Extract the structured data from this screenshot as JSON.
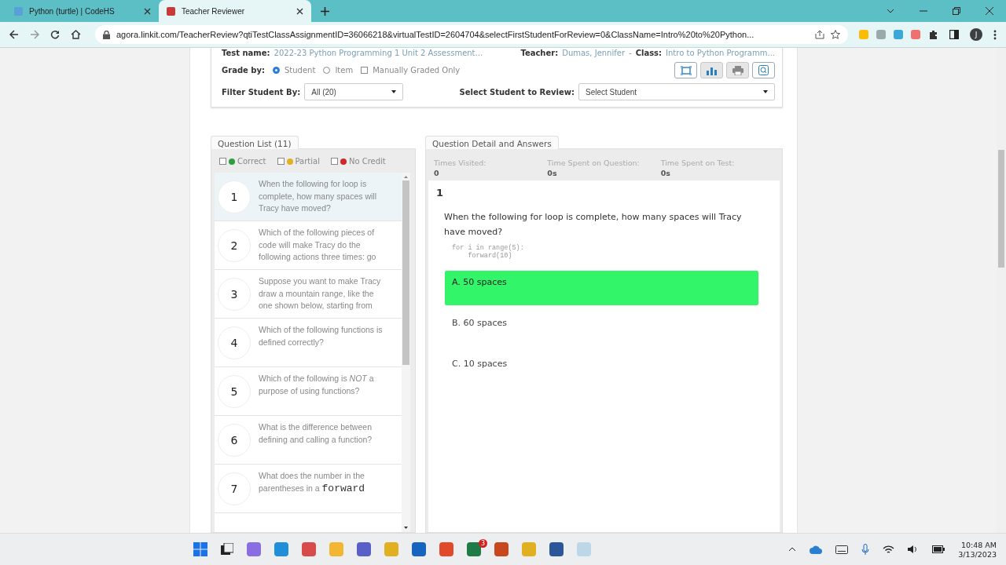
{
  "browser": {
    "tabs": [
      {
        "title": "Python (turtle) | CodeHS",
        "selected": false
      },
      {
        "title": "Teacher Reviewer",
        "selected": true
      }
    ],
    "url": "agora.linkit.com/TeacherReview?qtiTestClassAssignmentID=36066218&virtualTestID=2604704&selectFirstStudentForReview=0&ClassName=Intro%20to%20Python...",
    "profile_initial": "J"
  },
  "header": {
    "test_name_label": "Test name:",
    "test_name": "2022-23 Python Programming 1 Unit 2 Assessment...",
    "teacher_label": "Teacher:",
    "teacher": "Dumas, Jennifer",
    "separator": "-",
    "class_label": "Class:",
    "class": "Intro to Python Programm...",
    "grade_by_label": "Grade by:",
    "grade_by": [
      {
        "label": "Student",
        "selected": true
      },
      {
        "label": "Item",
        "selected": false
      }
    ],
    "manual": {
      "label": "Manually Graded Only",
      "checked": false
    },
    "filter_label": "Filter Student By:",
    "filter_value": "All (20)",
    "select_label": "Select Student to Review:",
    "select_value": "Select Student"
  },
  "question_list": {
    "title": "Question List (11)",
    "filters": [
      {
        "label": "Correct",
        "color": "#2e9e3e",
        "checked": false
      },
      {
        "label": "Partial",
        "color": "#e0b020",
        "checked": false
      },
      {
        "label": "No Credit",
        "color": "#d02828",
        "checked": false
      }
    ],
    "items": [
      {
        "number": "1",
        "text": "When the following for loop is complete, how many spaces will Tracy have moved?",
        "selected": true
      },
      {
        "number": "2",
        "text": "Which of the following pieces of code will make Tracy do the following actions three times: go",
        "selected": false
      },
      {
        "number": "3",
        "text": "Suppose you want to make Tracy draw a mountain range, like the one shown below, starting from",
        "selected": false
      },
      {
        "number": "4",
        "text": "Which of the following functions is defined correctly?",
        "selected": false
      },
      {
        "number": "5",
        "text": "Which of the following is *NOT* a purpose of using functions?",
        "selected": false
      },
      {
        "number": "6",
        "text": "What is the difference between defining and calling a function?",
        "selected": false
      },
      {
        "number": "7",
        "text": "What does the number in the parentheses in a",
        "code": "forward",
        "selected": false
      }
    ]
  },
  "detail": {
    "title": "Question Detail and Answers",
    "stats": [
      {
        "label": "Times Visited:",
        "value": "0"
      },
      {
        "label": "Time Spent on Question:",
        "value": "0s"
      },
      {
        "label": "Time Spent on Test:",
        "value": "0s"
      }
    ],
    "number": "1",
    "question": "When the following for loop is complete, how many spaces will Tracy have moved?",
    "code": [
      "for i in range(5):",
      "    forward(10)"
    ],
    "answers": [
      {
        "text": "A. 50 spaces",
        "correct": true
      },
      {
        "text": "B. 60 spaces",
        "correct": false
      },
      {
        "text": "C. 10 spaces",
        "correct": false
      }
    ]
  },
  "taskbar": {
    "badge": "3",
    "time": "10:48 AM",
    "date": "3/13/2023"
  }
}
